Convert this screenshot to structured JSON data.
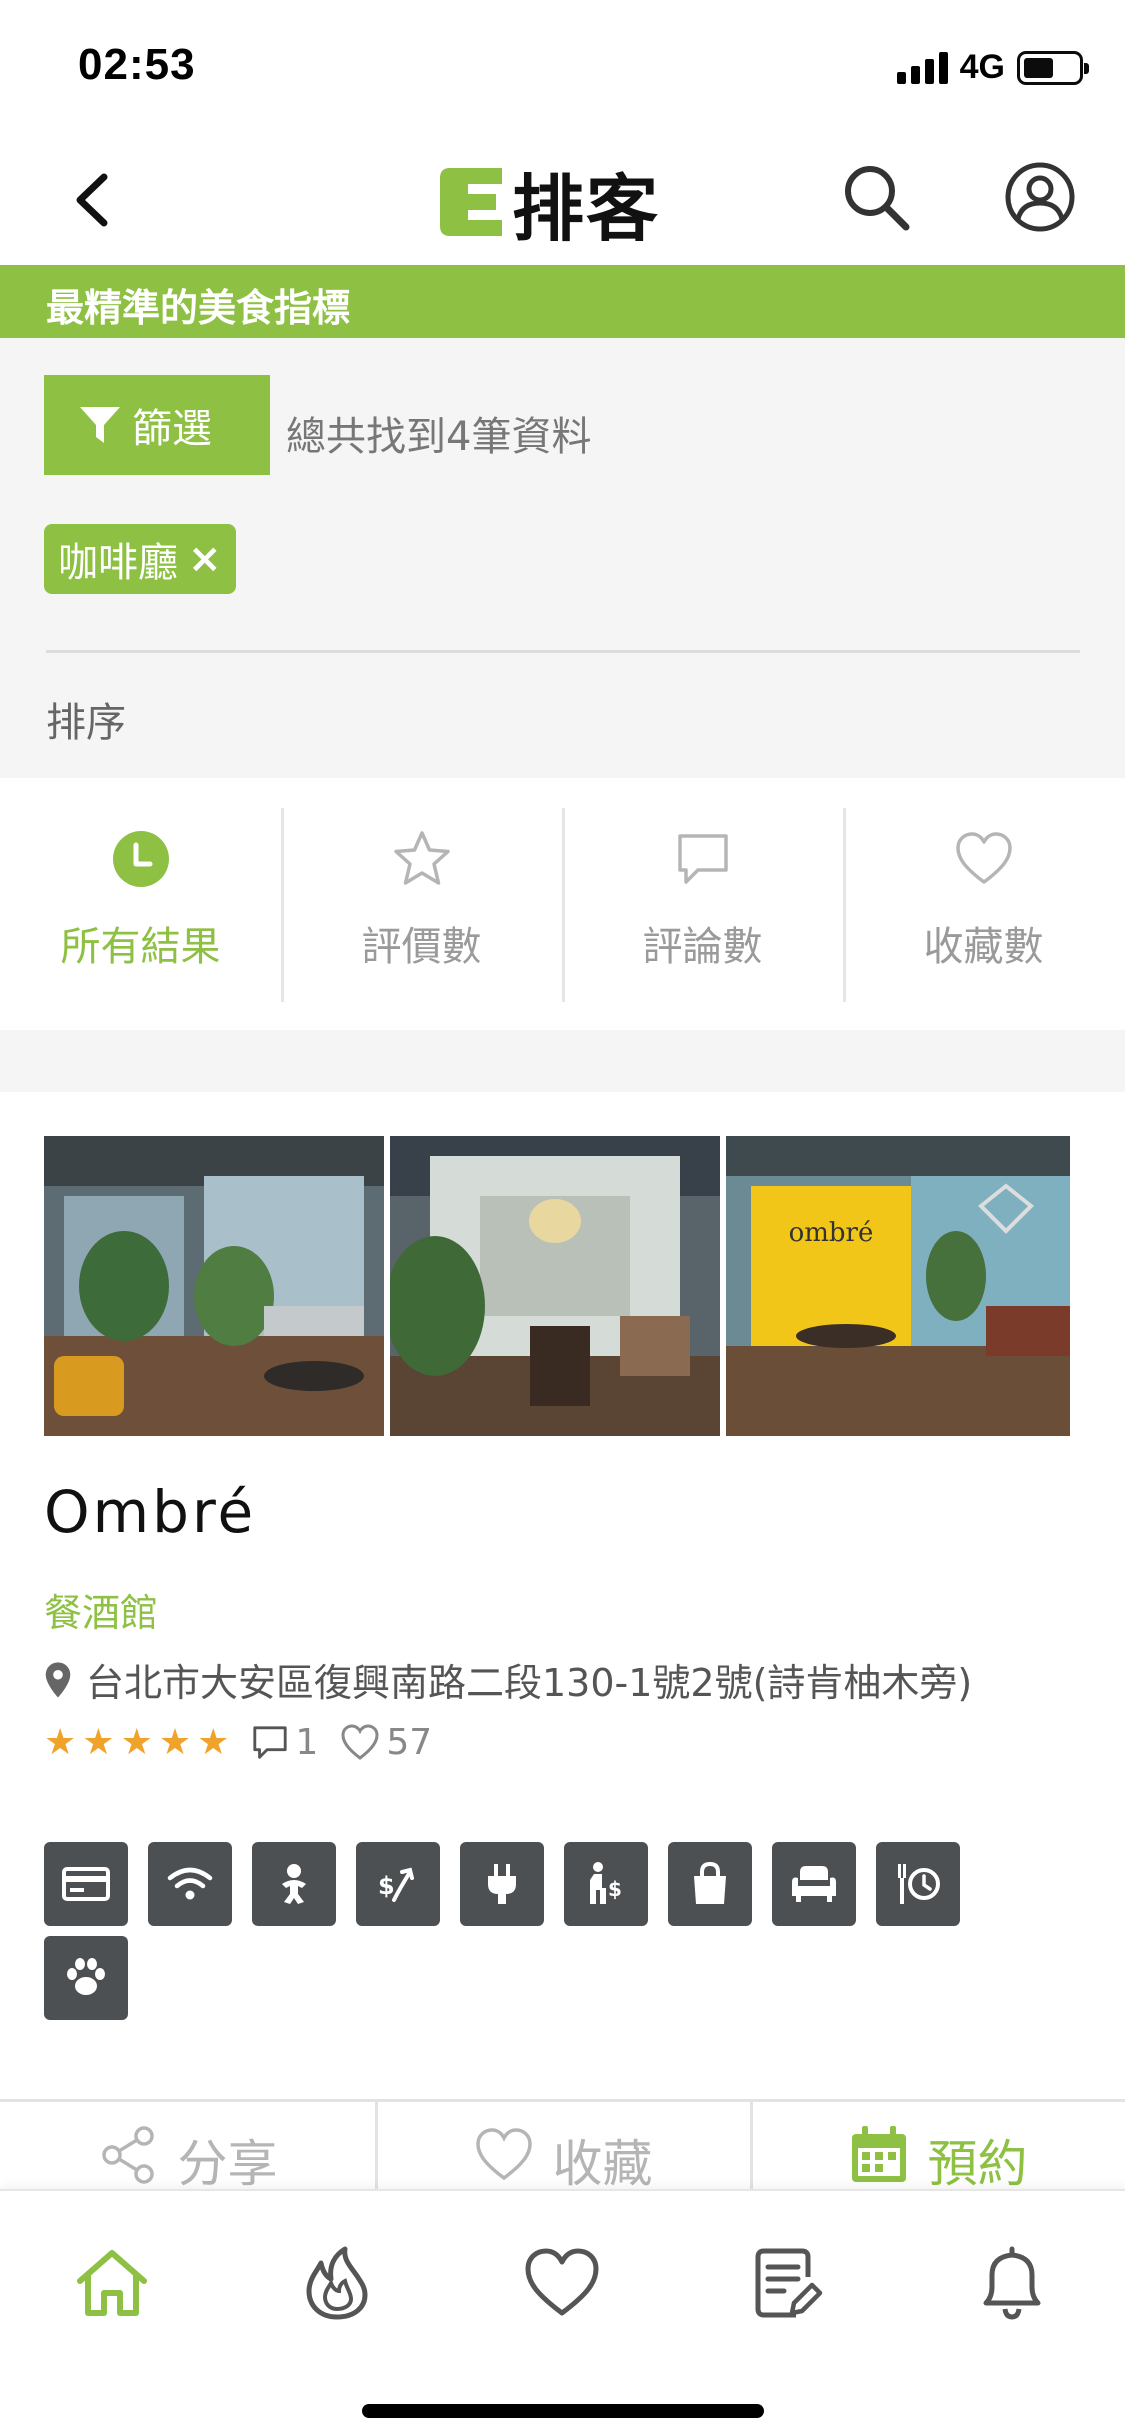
{
  "status_bar": {
    "time": "02:53",
    "network": "4G"
  },
  "header": {
    "logo_text": "排客",
    "logo_letter": "E"
  },
  "tagline": "最精準的美食指標",
  "filter": {
    "button_label": "篩選",
    "result_text": "總共找到4筆資料",
    "tags": [
      {
        "label": "咖啡廳",
        "remove": "×"
      }
    ],
    "sort_label": "排序"
  },
  "sort_tabs": [
    {
      "label": "所有結果",
      "icon": "clock-icon",
      "active": true
    },
    {
      "label": "評價數",
      "icon": "star-outline-icon",
      "active": false
    },
    {
      "label": "評論數",
      "icon": "comment-icon",
      "active": false
    },
    {
      "label": "收藏數",
      "icon": "heart-outline-icon",
      "active": false
    }
  ],
  "card": {
    "name": "Ombré",
    "category": "餐酒館",
    "address": "台北市大安區復興南路二段130-1號2號(詩肯柚木旁)",
    "rating_stars": 5,
    "comments": "1",
    "likes": "57",
    "photo_sign_text": "ombré",
    "features": [
      "credit-card-icon",
      "wifi-icon",
      "baby-icon",
      "service-fee-icon",
      "power-outlet-icon",
      "min-charge-icon",
      "takeout-bag-icon",
      "sofa-icon",
      "time-limit-icon",
      "pet-paw-icon"
    ]
  },
  "actions": [
    {
      "label": "分享",
      "icon": "share-icon"
    },
    {
      "label": "收藏",
      "icon": "heart-outline-icon"
    },
    {
      "label": "預約",
      "icon": "calendar-icon"
    }
  ],
  "bottom_nav": [
    "home-icon",
    "fire-icon",
    "heart-icon",
    "document-edit-icon",
    "bell-icon"
  ],
  "colors": {
    "brand_green": "#8dc043",
    "feature_bg": "#4d5052",
    "star": "#f0a32a"
  }
}
